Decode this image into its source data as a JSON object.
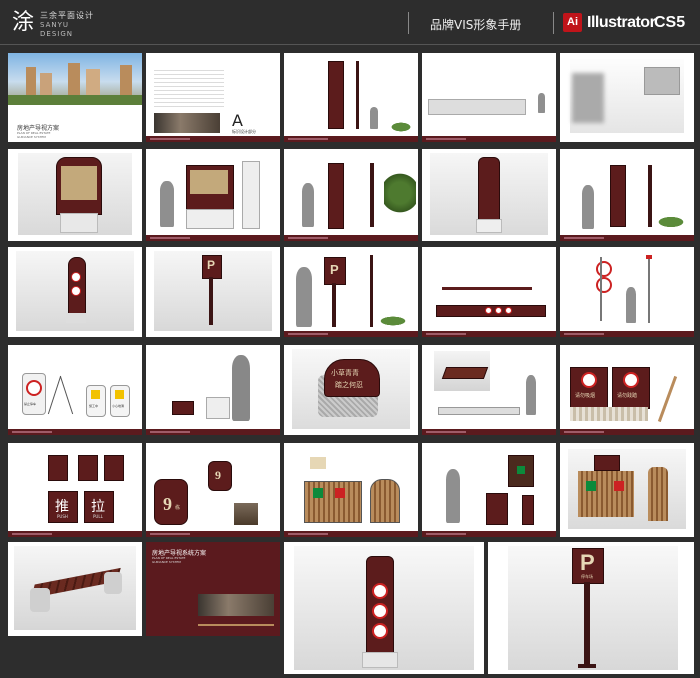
{
  "header": {
    "logo_glyph": "涂",
    "brand_cn": "三余平面设计",
    "brand_en_1": "SANYU",
    "brand_en_2": "DESIGN",
    "manual_title": "品牌VIS形象手册",
    "app_badge": "Ai",
    "app_name": "Illustrator",
    "app_version": "CS5"
  },
  "cover": {
    "title_cn": "房地产导视方案",
    "title_en_1": "PLAN OF REAL ESTATE",
    "title_en_2": "GUIDANCE SYSTEM"
  },
  "section_a": {
    "letter": "A",
    "caption": "标识设计部分"
  },
  "cover2": {
    "title_cn": "房地产导视系统方案",
    "title_en_1": "PLAN OF REAL ESTATE",
    "title_en_2": "GUIDANCE SYSTEM"
  },
  "signs": {
    "parking_p": "P",
    "parking_caption": "停车场",
    "no_parking": "禁止停车",
    "construction": "施工中",
    "safety": "小心地滑",
    "push": "推",
    "push_en": "PUSH",
    "pull": "拉",
    "pull_en": "PULL",
    "building_no": "9",
    "building_unit": "栋",
    "lawn_1": "小草青青",
    "lawn_2": "踏之何忍",
    "no_smoking": "请勿吸烟",
    "no_trample": "请勿践踏"
  }
}
